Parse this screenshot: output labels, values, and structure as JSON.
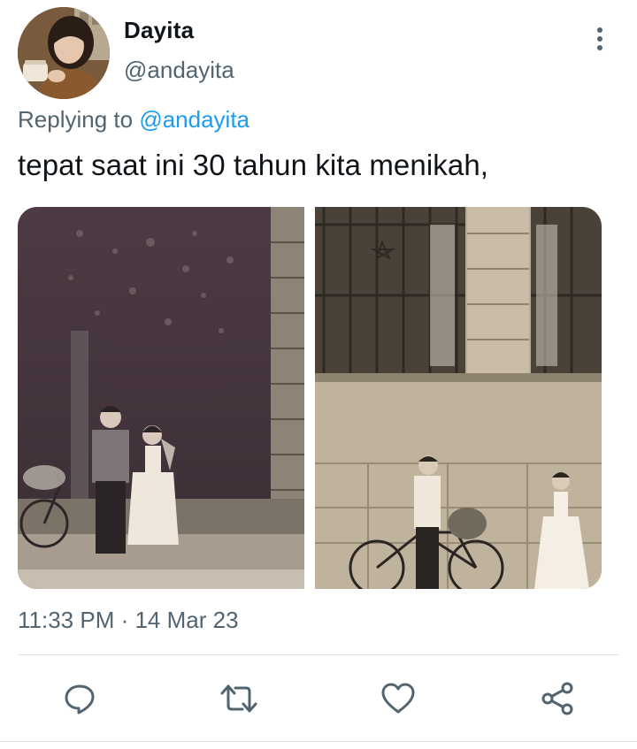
{
  "tweet": {
    "display_name": "Dayita",
    "handle": "@andayita",
    "replying_prefix": "Replying to",
    "replying_to": "@andayita",
    "text": "tepat saat ini 30 tahun kita menikah,",
    "timestamp": "11:33 PM · 14 Mar 23"
  },
  "actions": {
    "reply_icon": "reply-icon",
    "retweet_icon": "retweet-icon",
    "like_icon": "heart-icon",
    "share_icon": "share-icon"
  },
  "colors": {
    "link": "#1d9bf0",
    "secondary_text": "#536471",
    "icon": "#536471"
  }
}
